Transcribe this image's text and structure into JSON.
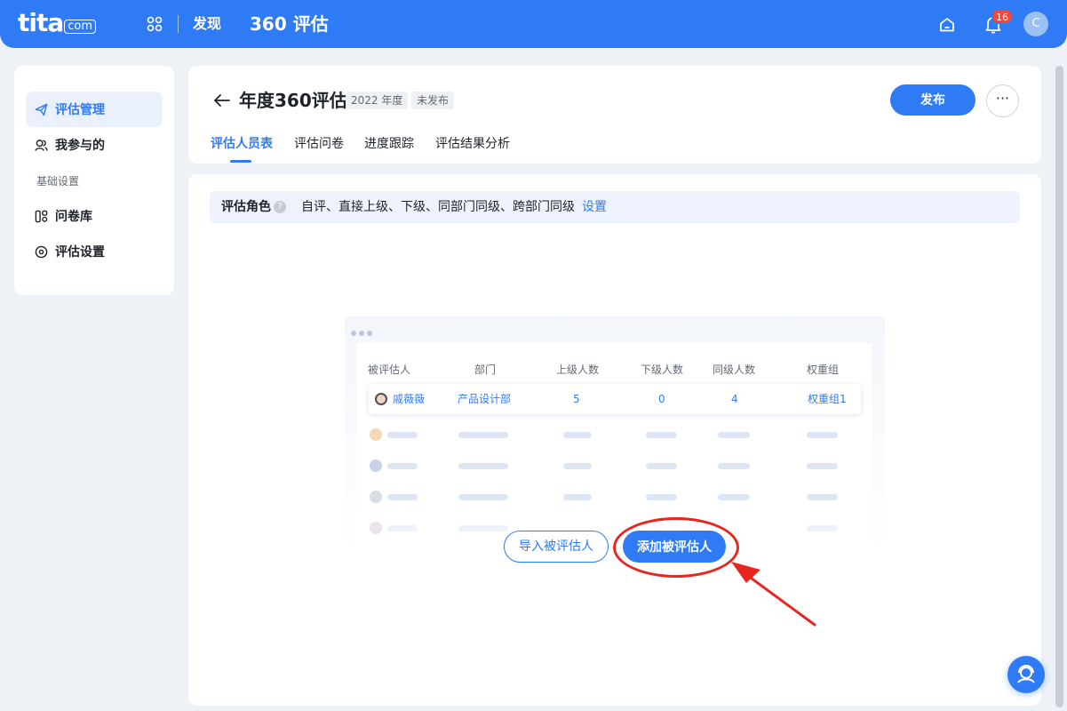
{
  "topbar": {
    "logo_main": "tita",
    "logo_suffix": "com",
    "discover": "发现",
    "title": "360 评估",
    "notification_count": "16",
    "avatar_initial": "C"
  },
  "sidebar": {
    "items": [
      {
        "label": "评估管理",
        "icon": "paper-plane-icon",
        "active": true
      },
      {
        "label": "我参与的",
        "icon": "people-icon",
        "active": false
      }
    ],
    "section_label": "基础设置",
    "settings_items": [
      {
        "label": "问卷库",
        "icon": "questionnaire-icon"
      },
      {
        "label": "评估设置",
        "icon": "settings-icon"
      }
    ]
  },
  "header": {
    "title": "年度360评估",
    "year_tag": "2022 年度",
    "status_tag": "未发布",
    "publish_label": "发布",
    "more_label": "···",
    "tabs": [
      "评估人员表",
      "评估问卷",
      "进度跟踪",
      "评估结果分析"
    ]
  },
  "role_bar": {
    "label": "评估角色",
    "help": "?",
    "roles": "自评、直接上级、下级、同部门同级、跨部门同级",
    "setting_link": "设置"
  },
  "illustration": {
    "headers": [
      "被评估人",
      "部门",
      "上级人数",
      "下级人数",
      "同级人数",
      "权重组"
    ],
    "example_row": {
      "name": "戚薇薇",
      "department": "产品设计部",
      "superiors": "5",
      "subordinates": "0",
      "peers": "4",
      "weight_group": "权重组1"
    }
  },
  "actions": {
    "import_label": "导入被评估人",
    "add_label": "添加被评估人"
  },
  "colors": {
    "primary": "#2f7bf6",
    "annotation": "#e8261f",
    "background": "#eef1f6"
  }
}
